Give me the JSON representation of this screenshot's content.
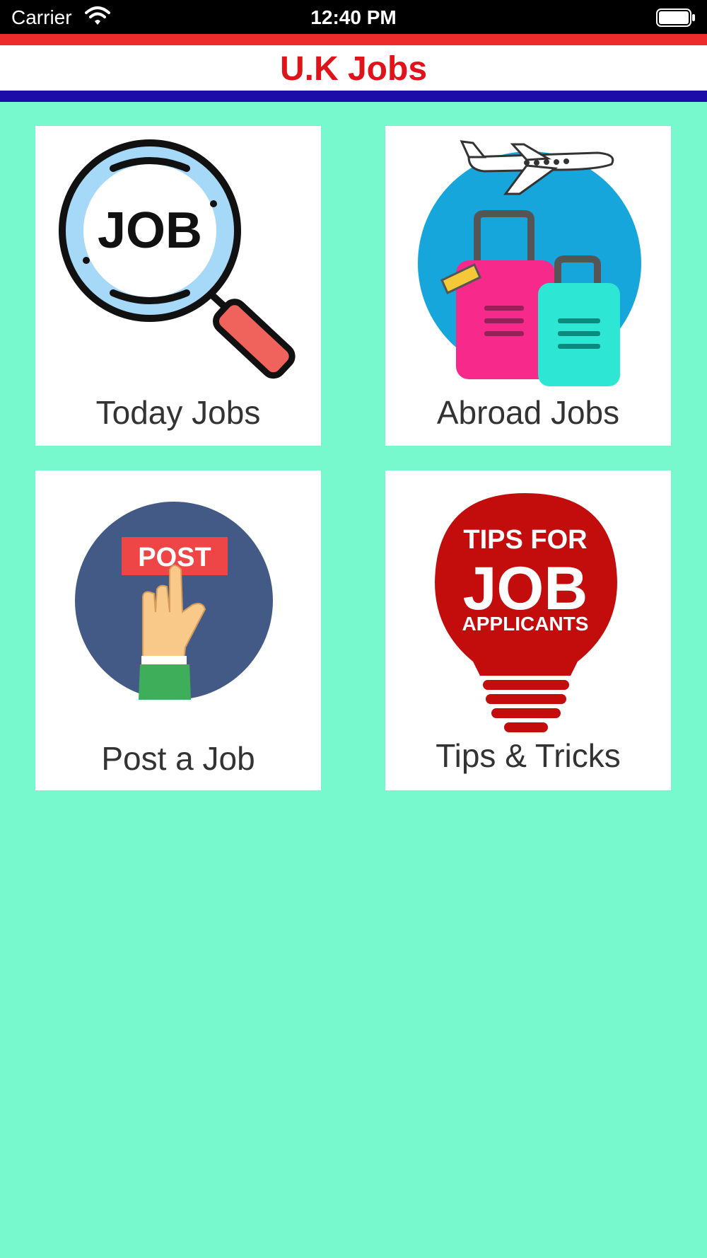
{
  "status_bar": {
    "carrier": "Carrier",
    "time": "12:40 PM"
  },
  "header": {
    "title": "U.K Jobs",
    "title_color": "#e0121a",
    "stripe_top_color": "#ee2b2b",
    "stripe_bottom_color": "#1d0da8"
  },
  "background_color": "#78f8cd",
  "tiles": [
    {
      "label": "Today Jobs",
      "icon": "job-search-magnifier-icon",
      "image_text": "JOB"
    },
    {
      "label": "Abroad Jobs",
      "icon": "airplane-luggage-icon"
    },
    {
      "label": "Post a Job",
      "icon": "post-button-hand-icon",
      "image_text": "POST"
    },
    {
      "label": "Tips & Tricks",
      "icon": "tips-bulb-icon",
      "image_text_lines": [
        "TIPS FOR",
        "JOB",
        "APPLICANTS"
      ]
    }
  ]
}
